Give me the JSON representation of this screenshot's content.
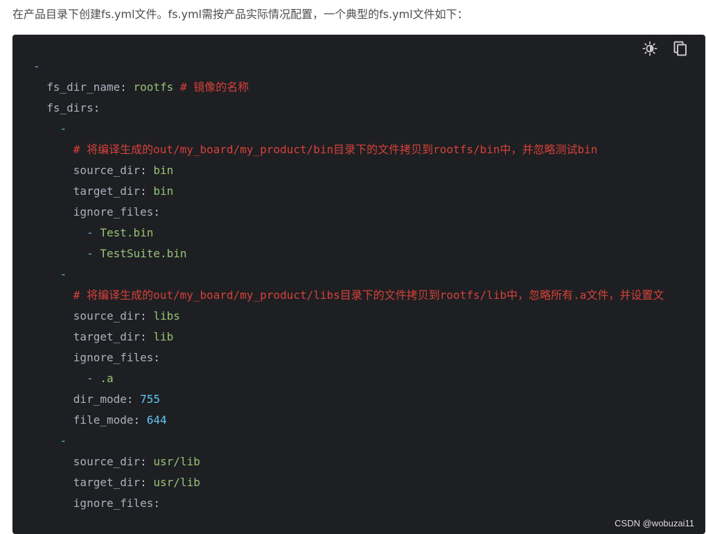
{
  "intro_text": "在产品目录下创建fs.yml文件。fs.yml需按产品实际情况配置，一个典型的fs.yml文件如下：",
  "toolbar": {
    "theme_icon": "theme-toggle-icon",
    "copy_icon": "copy-icon"
  },
  "code": {
    "lines": [
      {
        "indent": "",
        "dash": "-"
      },
      {
        "indent": "  ",
        "key": "fs_dir_name",
        "value": "rootfs",
        "comment": "# 镜像的名称"
      },
      {
        "indent": "  ",
        "key": "fs_dirs"
      },
      {
        "indent": "    ",
        "dash": "-"
      },
      {
        "indent": "      ",
        "comment": "# 将编译生成的out/my_board/my_product/bin目录下的文件拷贝到rootfs/bin中，并忽略测试bin"
      },
      {
        "indent": "      ",
        "key": "source_dir",
        "value": "bin"
      },
      {
        "indent": "      ",
        "key": "target_dir",
        "value": "bin"
      },
      {
        "indent": "      ",
        "key": "ignore_files"
      },
      {
        "indent": "        ",
        "item": "Test.bin"
      },
      {
        "indent": "        ",
        "item": "TestSuite.bin"
      },
      {
        "indent": "    ",
        "dash": "-"
      },
      {
        "indent": "      ",
        "comment": "# 将编译生成的out/my_board/my_product/libs目录下的文件拷贝到rootfs/lib中，忽略所有.a文件，并设置文"
      },
      {
        "indent": "      ",
        "key": "source_dir",
        "value": "libs"
      },
      {
        "indent": "      ",
        "key": "target_dir",
        "value": "lib"
      },
      {
        "indent": "      ",
        "key": "ignore_files"
      },
      {
        "indent": "        ",
        "item": ".a"
      },
      {
        "indent": "      ",
        "key": "dir_mode",
        "number": "755"
      },
      {
        "indent": "      ",
        "key": "file_mode",
        "number": "644"
      },
      {
        "indent": "    ",
        "dash": "-"
      },
      {
        "indent": "      ",
        "key": "source_dir",
        "value": "usr/lib"
      },
      {
        "indent": "      ",
        "key": "target_dir",
        "value": "usr/lib"
      },
      {
        "indent": "      ",
        "key": "ignore_files"
      }
    ]
  },
  "watermark": "CSDN @wobuzai11",
  "colors": {
    "background": "#1e1f22",
    "key": "#abb2bf",
    "string": "#98c379",
    "number": "#61c8f5",
    "comment": "#d6413a",
    "dash": "#5ab4e6"
  }
}
